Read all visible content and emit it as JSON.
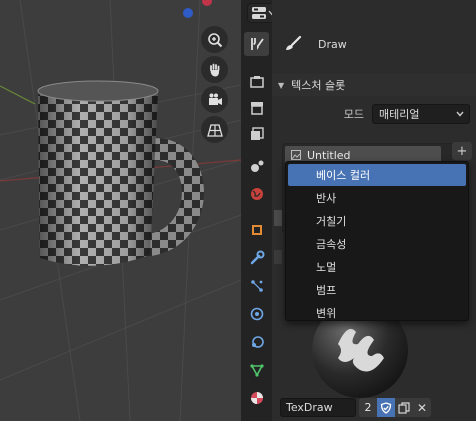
{
  "viewport": {
    "nav_icons": [
      "zoom-icon",
      "pan-hand-icon",
      "camera-icon",
      "grid-icon"
    ]
  },
  "properties": {
    "tool_name": "Draw",
    "section_title": "텍스처 슬롯",
    "mode_label": "모드",
    "mode_value": "매테리얼",
    "slot_item": "Untitled",
    "add_symbol": "+"
  },
  "menu": {
    "items": [
      "베이스 컬러",
      "반사",
      "거칠기",
      "금속성",
      "노멀",
      "범프",
      "변위"
    ],
    "highlighted_index": 0
  },
  "brush_bar": {
    "name": "TexDraw",
    "users": "2",
    "unlink_symbol": "✕"
  },
  "colors": {
    "accent": "#4772b3",
    "panel_bg": "#2c2c2c",
    "viewport_bg": "#3d3d3d",
    "tab_bg": "#232323",
    "menu_bg": "#181818"
  }
}
